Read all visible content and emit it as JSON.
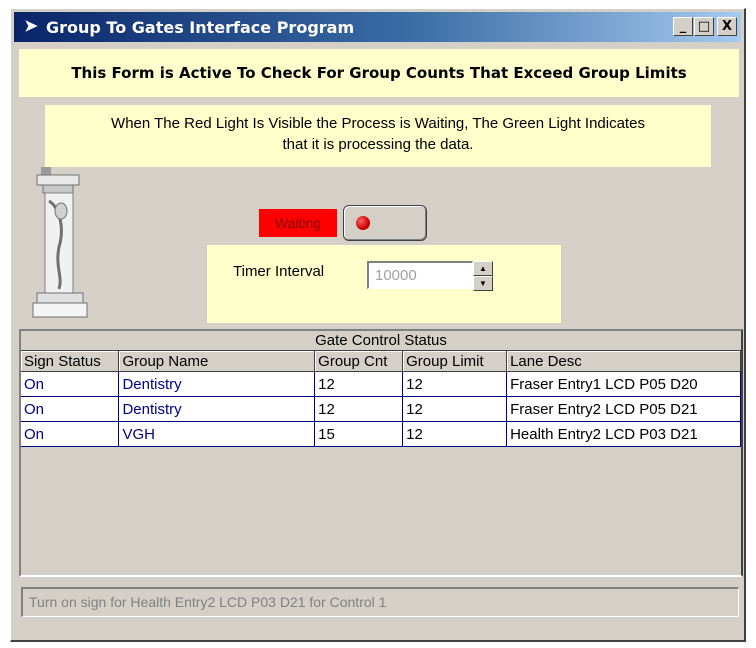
{
  "window": {
    "title": "Group To Gates Interface Program",
    "minimize_label": "_",
    "maximize_label": "□",
    "close_label": "X",
    "app_icon": "arrow-app-icon"
  },
  "banner": {
    "text": "This Form is Active To Check For Group Counts That Exceed Group Limits"
  },
  "info": {
    "line1": "When The Red Light Is Visible the Process is Waiting, The Green Light Indicates",
    "line2": "that it is processing the data."
  },
  "status_light": {
    "label": "Waiting",
    "state": "red",
    "colors": {
      "label_bg": "#ff0000",
      "light": "#cc0000"
    }
  },
  "timer": {
    "label": "Timer Interval",
    "value": "10000"
  },
  "grid": {
    "caption": "Gate Control Status",
    "columns": [
      "Sign Status",
      "Group Name",
      "Group Cnt",
      "Group Limit",
      "Lane Desc"
    ],
    "rows": [
      [
        "On",
        "Dentistry",
        "12",
        "12",
        "Fraser Entry1 LCD P05 D20"
      ],
      [
        "On",
        "Dentistry",
        "12",
        "12",
        "Fraser Entry2 LCD P05 D21"
      ],
      [
        "On",
        "VGH",
        "15",
        "12",
        "Health Entry2 LCD P03 D21"
      ]
    ]
  },
  "statusbar": {
    "text": "Turn on sign for Health Entry2 LCD P03 D21 for Control 1"
  },
  "colors": {
    "yellow_panel": "#ffffcc",
    "titlebar_start": "#0a246a",
    "titlebar_end": "#a6caf0",
    "window_face": "#d4d0c8"
  }
}
